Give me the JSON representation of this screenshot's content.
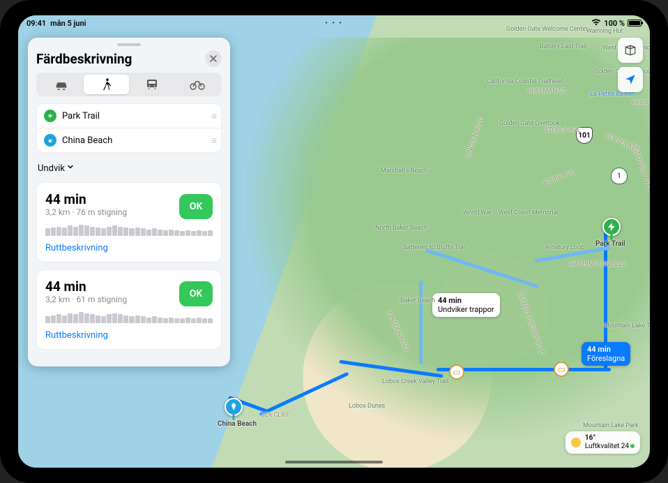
{
  "status": {
    "time": "09:41",
    "date": "mån 5 juni",
    "wifi": true,
    "battery_pct": "100 %",
    "ellipsis": "• • •"
  },
  "panel": {
    "title": "Färdbeskrivning",
    "close_aria": "Stäng",
    "modes": {
      "driving": "Bil",
      "walking": "Gång",
      "transit": "Kollektivtrafik",
      "cycling": "Cykel",
      "active": "walking"
    },
    "waypoints": [
      {
        "kind": "start",
        "label": "Park Trail"
      },
      {
        "kind": "end",
        "label": "China Beach"
      }
    ],
    "avoid_label": "Undvik",
    "routes": [
      {
        "time": "44 min",
        "subtitle": "3,2 km · 76 m stigning",
        "ok_label": "OK",
        "profile": [
          5,
          6,
          7,
          6,
          8,
          7,
          9,
          8,
          7,
          6,
          5,
          7,
          8,
          7,
          6,
          5,
          6,
          5,
          4,
          5,
          4,
          3,
          4,
          3,
          2,
          3,
          2,
          3,
          2,
          3
        ],
        "details_label": "Ruttbeskrivning"
      },
      {
        "time": "44 min",
        "subtitle": "3,2 km · 61 m stigning",
        "ok_label": "OK",
        "profile": [
          4,
          5,
          6,
          5,
          7,
          6,
          8,
          7,
          6,
          5,
          4,
          6,
          7,
          6,
          5,
          4,
          5,
          4,
          3,
          4,
          3,
          2,
          3,
          2,
          2,
          3,
          2,
          3,
          2,
          2
        ],
        "details_label": "Ruttbeskrivning"
      }
    ]
  },
  "map": {
    "controls": {
      "layers_aria": "Kartinställningar",
      "location_aria": "Visa aktuell plats"
    },
    "shields": {
      "us101": "101",
      "ca1": "1"
    },
    "labels": {
      "ggwc": "Golden Gate Welcome Center",
      "battery_east": "Battery East Trail",
      "warming_hut": "Warming Hut",
      "west_bluff": "West Bluff Picnic Area",
      "ggop_bay": "Golden Gate Overlook Pkwy Bay Trail",
      "ccth": "California Coastal Trailhead",
      "hoffman": "HOFFMAN ST",
      "la_petite": "La Petite Baleen",
      "gg_overlook": "Golden Gate Overlook",
      "airste": "Airste",
      "lincoln_blvd": "LINCOLN BLVD",
      "storey": "STOREY AVE",
      "cortes": "CORTES AVE",
      "mccdowell": "MCDOWELL AVE",
      "kobe": "KOBBE AVE",
      "marshalls": "Marshall's Beach",
      "wwii": "World War II West Coast Memorial",
      "n_baker": "North Baker Beach",
      "batteries_bluffs": "Batteries to Bluffs Trail",
      "amatury": "Amatury Loop",
      "washington": "WASHINGTON BLVD",
      "baker": "Baker Beach",
      "battery_crosby": "BATTERY CROSBY BLVD",
      "lincoln_blvd2": "LINCOLN BLVD",
      "park_trail_pin": "Park Trail",
      "mtn_lake_trail": "Mountain Lake Trail",
      "lobos_valley": "Lobos Creek Valley Trail",
      "lobos_dunes": "Lobos Dunes",
      "sea_cliff": "SEA CLIFF",
      "china_beach_pin": "China Beach",
      "mtn_lake_park": "Mountain Lake Park"
    },
    "callouts": [
      {
        "kind": "alt",
        "time": "44 min",
        "sub": "Undviker trappor"
      },
      {
        "kind": "primary",
        "time": "44 min",
        "sub": "Föreslagna"
      }
    ]
  },
  "weather": {
    "temp": "16°",
    "aqi_label": "Luftkvalitet 24"
  }
}
